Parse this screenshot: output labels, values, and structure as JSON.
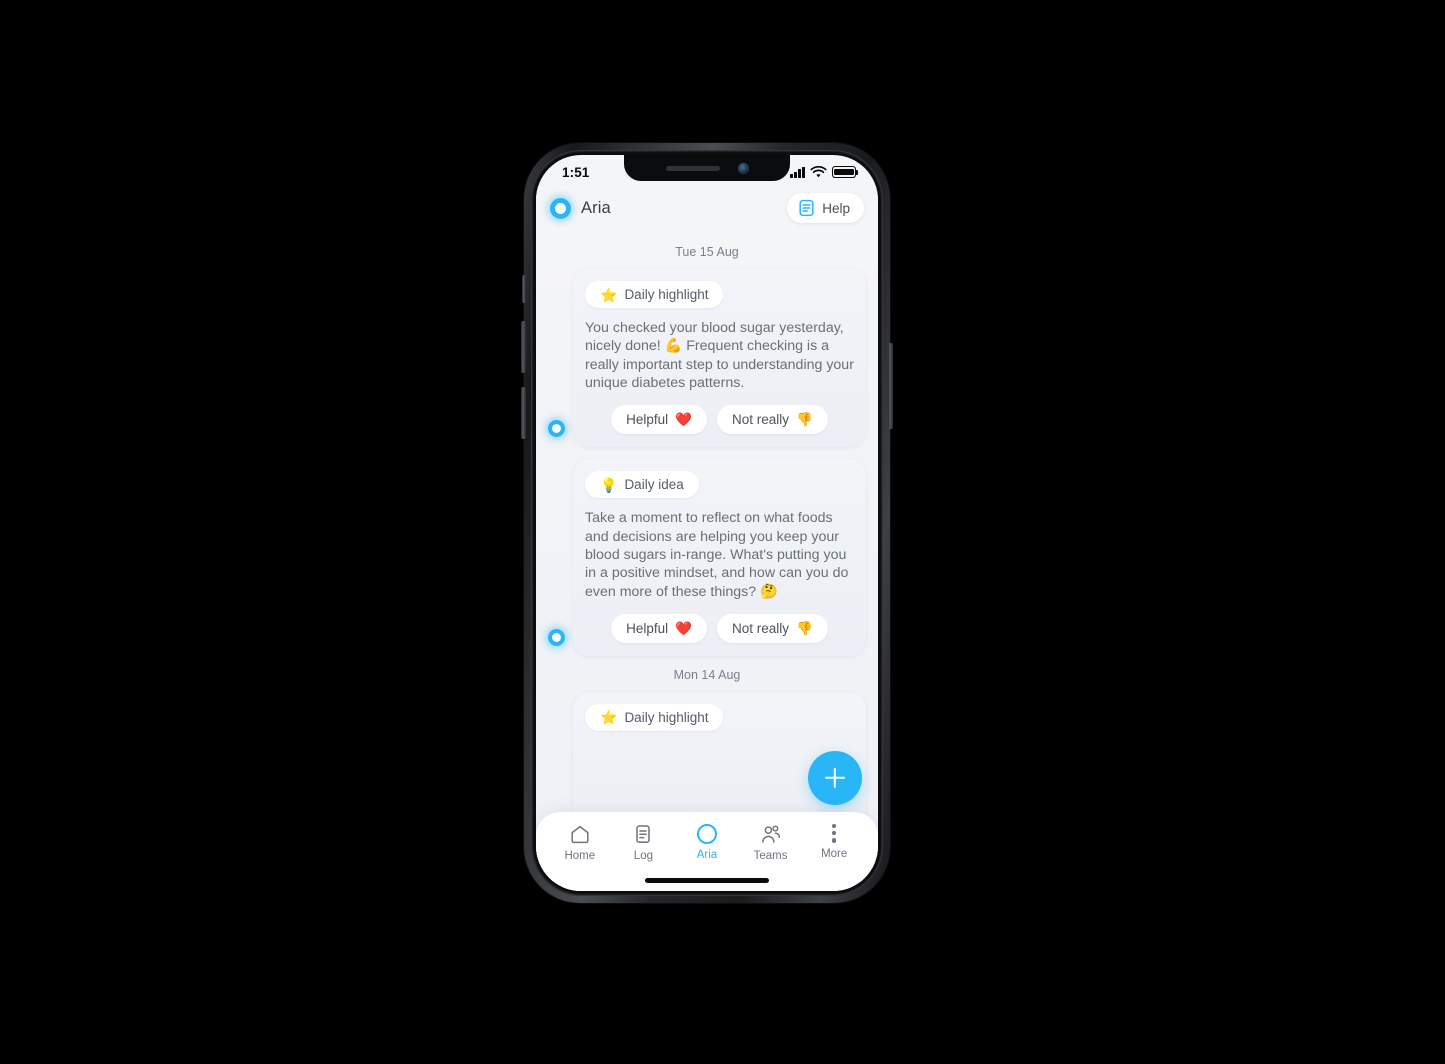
{
  "status_bar": {
    "time": "1:51",
    "signal_icon": "cellular-bars-icon",
    "wifi_icon": "wifi-icon",
    "battery_icon": "battery-full-icon"
  },
  "header": {
    "avatar_icon": "aria-assistant-avatar-icon",
    "title": "Aria",
    "help_button": {
      "label": "Help",
      "icon": "document-help-icon"
    }
  },
  "chat": {
    "day_separators": {
      "first": "Tue 15 Aug",
      "second": "Mon 14 Aug"
    },
    "messages": [
      {
        "avatar_icon": "aria-assistant-avatar-icon",
        "chip_emoji": "⭐",
        "chip_label": "Daily highlight",
        "text": "You checked your blood sugar yesterday, nicely done! 💪 Frequent checking is a really important step to understanding your unique diabetes patterns.",
        "reactions": [
          {
            "label": "Helpful",
            "emoji": "❤️"
          },
          {
            "label": "Not really",
            "emoji": "👎"
          }
        ]
      },
      {
        "avatar_icon": "aria-assistant-avatar-icon",
        "chip_emoji": "💡",
        "chip_label": "Daily idea",
        "text": "Take a moment to reflect on what foods and decisions are helping you keep your blood sugars in-range. What's putting you in a positive mindset, and how can you do even more of these things? 🤔",
        "reactions": [
          {
            "label": "Helpful",
            "emoji": "❤️"
          },
          {
            "label": "Not really",
            "emoji": "👎"
          }
        ]
      },
      {
        "avatar_icon": "aria-assistant-avatar-icon",
        "chip_emoji": "⭐",
        "chip_label": "Daily highlight",
        "text": "",
        "reactions": []
      }
    ]
  },
  "fab": {
    "label": "+",
    "icon": "plus-icon",
    "color": "#29b6f6"
  },
  "bottom_nav": {
    "active": "Aria",
    "accent_color": "#29b6f6",
    "items": [
      {
        "label": "Home",
        "icon": "home-icon"
      },
      {
        "label": "Log",
        "icon": "log-document-icon"
      },
      {
        "label": "Aria",
        "icon": "aria-ring-icon"
      },
      {
        "label": "Teams",
        "icon": "teams-people-icon"
      },
      {
        "label": "More",
        "icon": "more-dots-icon"
      }
    ]
  }
}
